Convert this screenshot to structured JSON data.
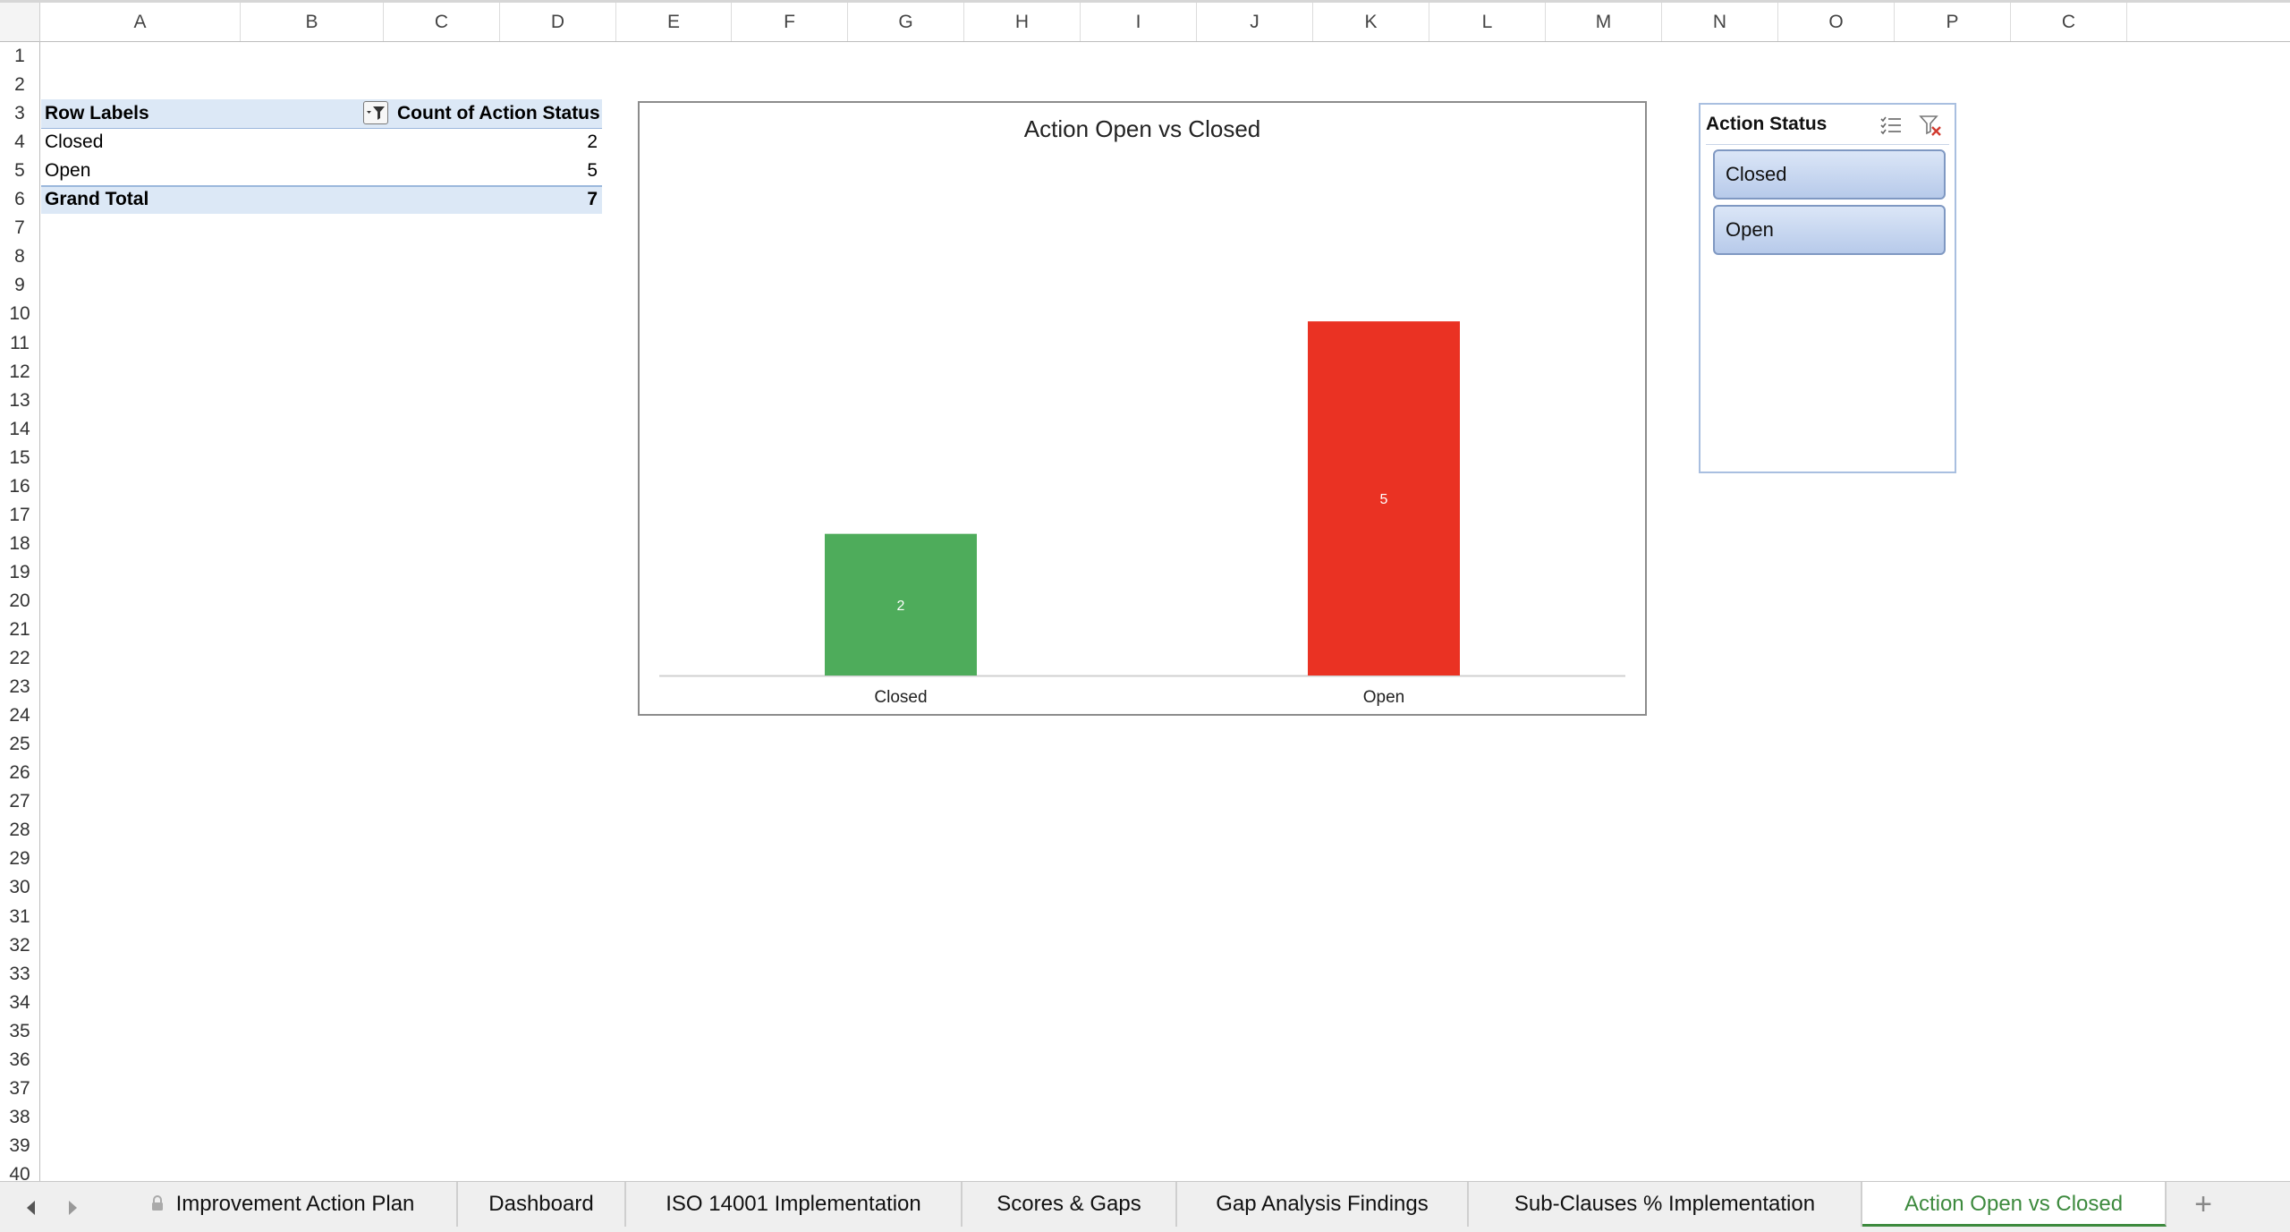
{
  "columns": [
    "A",
    "B",
    "C",
    "D",
    "E",
    "F",
    "G",
    "H",
    "I",
    "J",
    "K",
    "L",
    "M",
    "N",
    "O",
    "P",
    "C"
  ],
  "rows": [
    "1",
    "2",
    "3",
    "4",
    "5",
    "6",
    "7",
    "8",
    "9",
    "10",
    "11",
    "12",
    "13",
    "14",
    "15",
    "16",
    "17",
    "18",
    "19",
    "20",
    "21",
    "22",
    "23",
    "24",
    "25",
    "26",
    "27",
    "28",
    "29",
    "30",
    "31",
    "32",
    "33",
    "34",
    "35",
    "36",
    "37",
    "38",
    "39",
    "40"
  ],
  "pivot": {
    "header_labels": "Row Labels",
    "header_values": "Count of Action Status",
    "rows": [
      {
        "label": "Closed",
        "value": "2"
      },
      {
        "label": "Open",
        "value": "5"
      }
    ],
    "total_label": "Grand Total",
    "total_value": "7"
  },
  "chart_data": {
    "type": "bar",
    "title": "Action Open vs Closed",
    "categories": [
      "Closed",
      "Open"
    ],
    "values": [
      2,
      5
    ],
    "colors": [
      "#4eac5b",
      "#ea3223"
    ],
    "data_labels": [
      "2",
      "5"
    ],
    "ylim": [
      0,
      6
    ],
    "grid": false,
    "legend": "none",
    "xlabel": "",
    "ylabel": ""
  },
  "slicer": {
    "title": "Action Status",
    "items": [
      "Closed",
      "Open"
    ],
    "icons": [
      "multi-select-icon",
      "clear-filter-icon"
    ]
  },
  "tabs": [
    {
      "label": "Improvement Action Plan",
      "locked": true
    },
    {
      "label": "Dashboard"
    },
    {
      "label": "ISO 14001 Implementation"
    },
    {
      "label": "Scores & Gaps"
    },
    {
      "label": "Gap Analysis Findings"
    },
    {
      "label": "Sub-Clauses % Implementation"
    },
    {
      "label": "Action Open vs Closed",
      "active": true
    }
  ],
  "add_tab_label": "+",
  "accent_color": "#3d8a3e"
}
